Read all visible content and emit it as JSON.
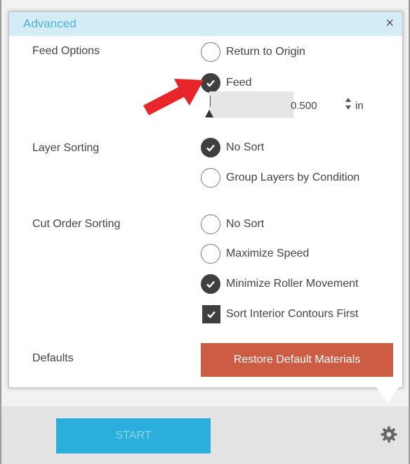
{
  "dialog": {
    "title": "Advanced",
    "close_glyph": "×"
  },
  "feed_options": {
    "label": "Feed Options",
    "return_to_origin": "Return to Origin",
    "feed": "Feed",
    "selected": "feed",
    "feed_value": "0.500",
    "feed_unit": "in"
  },
  "layer_sorting": {
    "label": "Layer Sorting",
    "no_sort": "No Sort",
    "group_layers": "Group Layers by Condition",
    "selected": "no_sort"
  },
  "cut_order_sorting": {
    "label": "Cut Order Sorting",
    "no_sort": "No Sort",
    "maximize_speed": "Maximize Speed",
    "minimize_roller": "Minimize Roller Movement",
    "selected": "minimize_roller",
    "sort_interior": "Sort Interior Contours First",
    "sort_interior_checked": true
  },
  "defaults": {
    "label": "Defaults",
    "restore_button": "Restore Default Materials"
  },
  "footer": {
    "start_button": "START",
    "gear_icon": "gear-icon"
  },
  "colors": {
    "accent_blue": "#2aaedb",
    "restore_orange": "#cc5d44",
    "annotation_red": "#e8262a"
  }
}
